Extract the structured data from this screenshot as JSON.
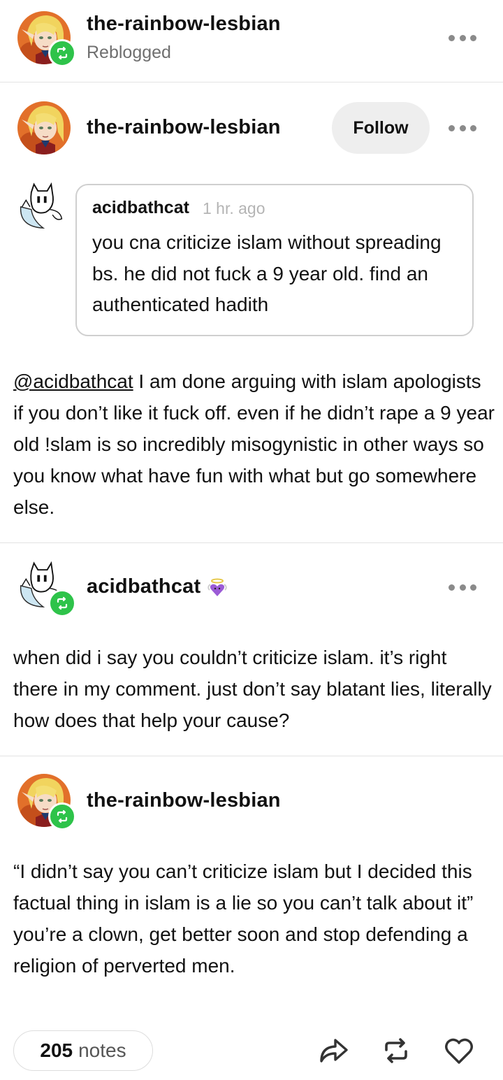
{
  "header": {
    "username": "the-rainbow-lesbian",
    "status": "Reblogged",
    "avatar_icon": "elf-avatar",
    "badge_icon": "reblog-icon"
  },
  "post": {
    "username": "the-rainbow-lesbian",
    "follow_label": "Follow",
    "ask": {
      "asker": "acidbathcat",
      "time": "1 hr. ago",
      "text": "you cna criticize islam without spreading bs. he did not fuck a 9 year old. find an authenticated hadith"
    },
    "answer": {
      "mention": "@acidbathcat",
      "text": " I am done arguing with islam apologists if you don’t like it fuck off. even if he didn’t rape a 9 year old !slam is so incredibly misogynistic in other ways so you know what have fun with what but go somewhere else."
    }
  },
  "reply1": {
    "username": "acidbathcat",
    "emoji_icon": "angel-purple-heart-icon",
    "text": "when did i say you couldn’t criticize islam. it’s right there in my comment. just don’t say blatant lies, literally how does that help your cause?"
  },
  "reply2": {
    "username": "the-rainbow-lesbian",
    "text": "“I didn’t say you can’t criticize islam but I decided this factual thing in islam is a lie so you can’t talk about it” you’re a clown, get better soon and stop defending a religion of perverted men."
  },
  "footer": {
    "notes_count": "205",
    "notes_label": "notes",
    "icons": [
      "share-icon",
      "reblog-icon",
      "heart-icon"
    ]
  },
  "colors": {
    "badge_green": "#2ec34a",
    "divider": "#e3e3e3",
    "muted_text": "#6f6f6f"
  }
}
